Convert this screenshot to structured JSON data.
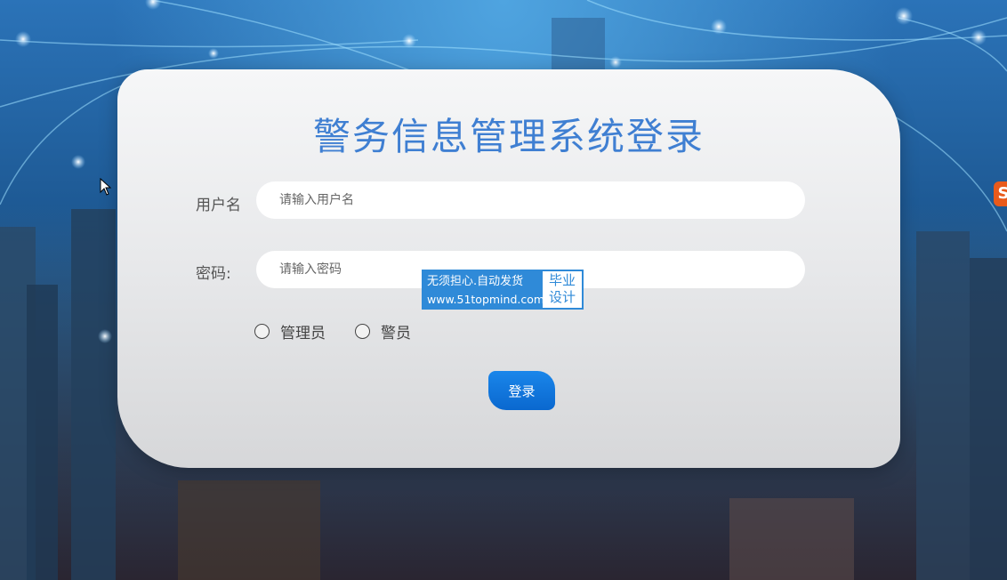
{
  "login": {
    "title": "警务信息管理系统登录",
    "username_label": "用户名",
    "username_placeholder": "请输入用户名",
    "password_label": "密码:",
    "password_placeholder": "请输入密码",
    "roles": [
      {
        "label": "管理员",
        "selected": false
      },
      {
        "label": "警员",
        "selected": false
      }
    ],
    "submit_label": "登录"
  },
  "watermark": {
    "line1": "无须担心.自动发货",
    "line2": "www.51topmind.com",
    "side1": "毕业",
    "side2": "设计"
  },
  "colors": {
    "title": "#3f7fd2",
    "button": "#0a68cf",
    "watermark": "#2f8ad8"
  }
}
